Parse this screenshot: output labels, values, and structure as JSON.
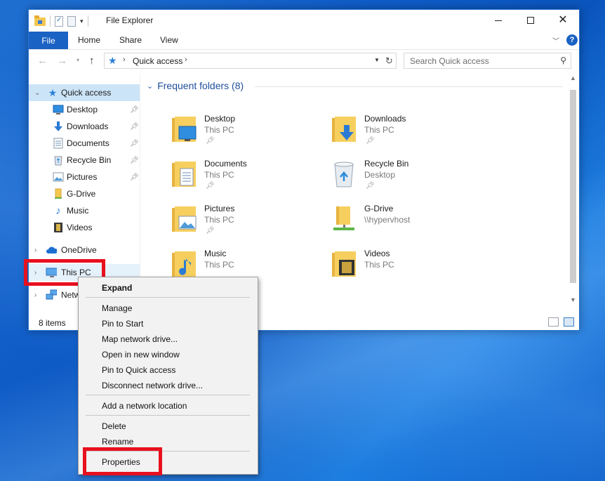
{
  "window": {
    "title": "File Explorer",
    "ribbon_tabs": [
      "File",
      "Home",
      "Share",
      "View"
    ]
  },
  "navbar": {
    "address_path": "Quick access",
    "search_placeholder": "Search Quick access"
  },
  "sidebar": {
    "quick_access": "Quick access",
    "items": [
      {
        "label": "Desktop",
        "pinned": true
      },
      {
        "label": "Downloads",
        "pinned": true
      },
      {
        "label": "Documents",
        "pinned": true
      },
      {
        "label": "Recycle Bin",
        "pinned": true
      },
      {
        "label": "Pictures",
        "pinned": true
      },
      {
        "label": "G-Drive",
        "pinned": false
      },
      {
        "label": "Music",
        "pinned": false
      },
      {
        "label": "Videos",
        "pinned": false
      }
    ],
    "onedrive": "OneDrive",
    "this_pc": "This PC",
    "network": "Netw"
  },
  "content": {
    "group_title": "Frequent folders (8)",
    "folders": [
      {
        "name": "Desktop",
        "location": "This PC",
        "pinned": true
      },
      {
        "name": "Downloads",
        "location": "This PC",
        "pinned": true
      },
      {
        "name": "Documents",
        "location": "This PC",
        "pinned": true
      },
      {
        "name": "Recycle Bin",
        "location": "Desktop",
        "pinned": true
      },
      {
        "name": "Pictures",
        "location": "This PC",
        "pinned": true
      },
      {
        "name": "G-Drive",
        "location": "\\\\hypervhost",
        "pinned": false
      },
      {
        "name": "Music",
        "location": "This PC",
        "pinned": false
      },
      {
        "name": "Videos",
        "location": "This PC",
        "pinned": false
      }
    ]
  },
  "status": {
    "item_count": "8 items"
  },
  "context_menu": {
    "items": [
      "Expand",
      "Manage",
      "Pin to Start",
      "Map network drive...",
      "Open in new window",
      "Pin to Quick access",
      "Disconnect network drive...",
      "Add a network location",
      "Delete",
      "Rename",
      "Properties"
    ]
  },
  "colors": {
    "accent": "#1a62c3",
    "selection": "#cce4f7",
    "highlight_box": "#e8101e",
    "folder": "#f4c74f"
  }
}
